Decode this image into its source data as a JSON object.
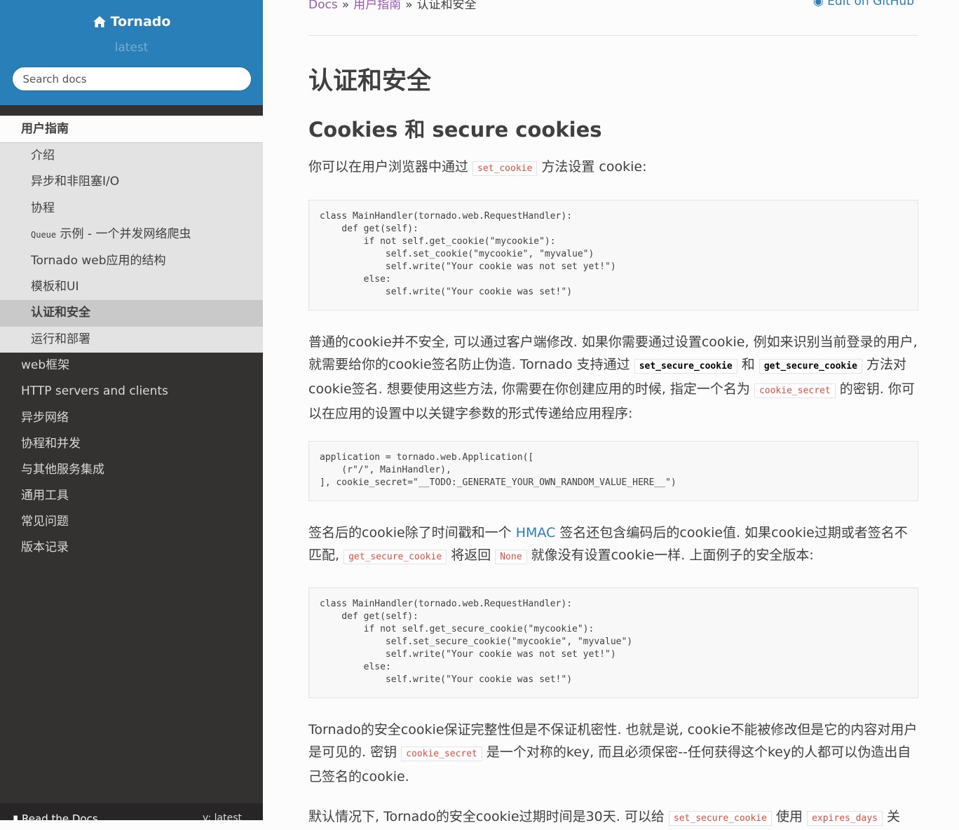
{
  "sidebar": {
    "brand": "Tornado",
    "version": "latest",
    "search_placeholder": "Search docs",
    "current_section": "用户指南",
    "sub_items": [
      {
        "prefix": "",
        "label": "介绍"
      },
      {
        "prefix": "",
        "label": "异步和非阻塞I/O"
      },
      {
        "prefix": "",
        "label": "协程"
      },
      {
        "prefix": "Queue",
        "label": " 示例 - 一个并发网络爬虫"
      },
      {
        "prefix": "",
        "label": "Tornado web应用的结构"
      },
      {
        "prefix": "",
        "label": "模板和UI"
      },
      {
        "prefix": "",
        "label": "认证和安全"
      },
      {
        "prefix": "",
        "label": "运行和部署"
      }
    ],
    "items": [
      "web框架",
      "HTTP servers and clients",
      "异步网络",
      "协程和并发",
      "与其他服务集成",
      "通用工具",
      "常见问题",
      "版本记录"
    ],
    "footer_label": "Read the Docs",
    "footer_version": "v: latest"
  },
  "breadcrumb": {
    "docs": "Docs",
    "sep": "»",
    "guide": "用户指南",
    "current": "认证和安全",
    "edit": "Edit on GitHub"
  },
  "page": {
    "title": "认证和安全",
    "section_title": "Cookies 和 secure cookies",
    "p1": {
      "a": "你可以在用户浏览器中通过 ",
      "code": "set_cookie",
      "b": " 方法设置 cookie:"
    },
    "code1": "class MainHandler(tornado.web.RequestHandler):\n    def get(self):\n        if not self.get_cookie(\"mycookie\"):\n            self.set_cookie(\"mycookie\", \"myvalue\")\n            self.write(\"Your cookie was not set yet!\")\n        else:\n            self.write(\"Your cookie was set!\")",
    "p2": {
      "a": "普通的cookie并不安全, 可以通过客户端修改. 如果你需要通过设置cookie, 例如来识别当前登录的用户, 就需要给你的cookie签名防止伪造. Tornado 支持通过 ",
      "code1": "set_secure_cookie",
      "b": " 和 ",
      "code2": "get_secure_cookie",
      "c": " 方法对cookie签名. 想要使用这些方法, 你需要在你创建应用的时候, 指定一个名为 ",
      "code3": "cookie_secret",
      "d": " 的密钥. 你可以在应用的设置中以关键字参数的形式传递给应用程序:"
    },
    "code2": "application = tornado.web.Application([\n    (r\"/\", MainHandler),\n], cookie_secret=\"__TODO:_GENERATE_YOUR_OWN_RANDOM_VALUE_HERE__\")",
    "p3": {
      "a": "签名后的cookie除了时间戳和一个 ",
      "link": "HMAC",
      "b": " 签名还包含编码后的cookie值. 如果cookie过期或者签名不匹配, ",
      "code1": "get_secure_cookie",
      "c": " 将返回 ",
      "code2": "None",
      "d": " 就像没有设置cookie一样. 上面例子的安全版本:"
    },
    "code3": "class MainHandler(tornado.web.RequestHandler):\n    def get(self):\n        if not self.get_secure_cookie(\"mycookie\"):\n            self.set_secure_cookie(\"mycookie\", \"myvalue\")\n            self.write(\"Your cookie was not set yet!\")\n        else:\n            self.write(\"Your cookie was set!\")",
    "p4": {
      "a": "Tornado的安全cookie保证完整性但是不保证机密性. 也就是说, cookie不能被修改但是它的内容对用户是可见的. 密钥 ",
      "code": "cookie_secret",
      "b": " 是一个对称的key, 而且必须保密--任何获得这个key的人都可以伪造出自己签名的cookie."
    },
    "p5": {
      "a": "默认情况下, Tornado的安全cookie过期时间是30天. 可以给 ",
      "code1": "set_secure_cookie",
      "b": " 使用 ",
      "code2": "expires_days",
      "c": " 关"
    }
  }
}
